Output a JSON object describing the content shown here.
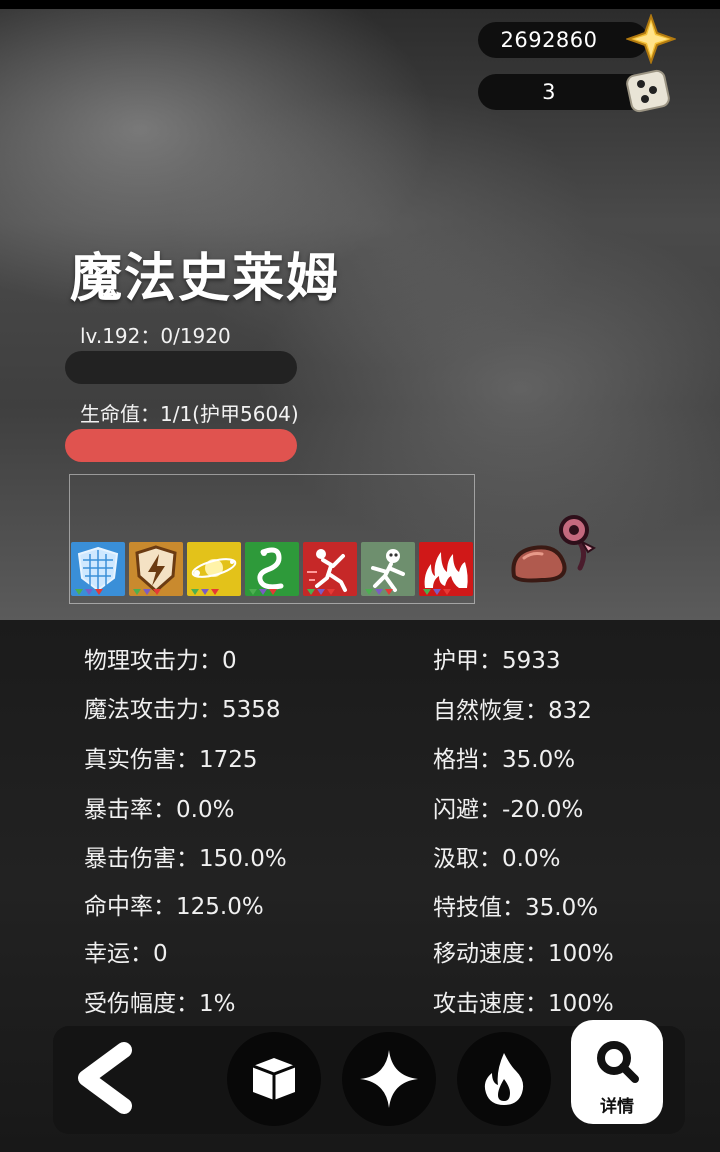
{
  "currency": [
    {
      "name": "gold",
      "value": "2692860",
      "icon": "gold-star-icon"
    },
    {
      "name": "dice",
      "value": "3",
      "icon": "dice-icon"
    }
  ],
  "character": {
    "name": "魔法史莱姆",
    "level_text": "lv.192：0/1920",
    "level_progress": 0,
    "hp_text": "生命值：1/1(护甲5604)",
    "hp_fraction": 1.0
  },
  "skills": [
    {
      "icon": "scale-shield-icon",
      "color": "#3a8fd8"
    },
    {
      "icon": "lightning-shield-icon",
      "color": "#c98a2e"
    },
    {
      "icon": "orbit-icon",
      "color": "#e3c21a"
    },
    {
      "icon": "serpent-icon",
      "color": "#2e9a3a"
    },
    {
      "icon": "dash-runner-icon",
      "color": "#c62828"
    },
    {
      "icon": "skull-shaman-icon",
      "color": "#6e8f6e"
    },
    {
      "icon": "flames-icon",
      "color": "#d01818"
    }
  ],
  "stats_left": [
    {
      "text": "物理攻击力：0"
    },
    {
      "text": "魔法攻击力：5358"
    },
    {
      "text": "真实伤害：1725"
    },
    {
      "text": "暴击率：0.0%"
    },
    {
      "text": "暴击伤害：150.0%"
    },
    {
      "text": "命中率：125.0%"
    },
    {
      "text": "幸运：0"
    },
    {
      "text": "受伤幅度：1%"
    }
  ],
  "stats_right": [
    {
      "text": "护甲：5933"
    },
    {
      "text": "自然恢复：832"
    },
    {
      "text": "格挡：35.0%"
    },
    {
      "text": "闪避：-20.0%"
    },
    {
      "text": "汲取：0.0%"
    },
    {
      "text": "特技值：35.0%"
    },
    {
      "text": "移动速度：100%"
    },
    {
      "text": "攻击速度：100%"
    }
  ],
  "nav": {
    "detail_label": "详情"
  },
  "colors": {
    "hp_bar": "#e0534f",
    "level_bar": "#222222"
  }
}
